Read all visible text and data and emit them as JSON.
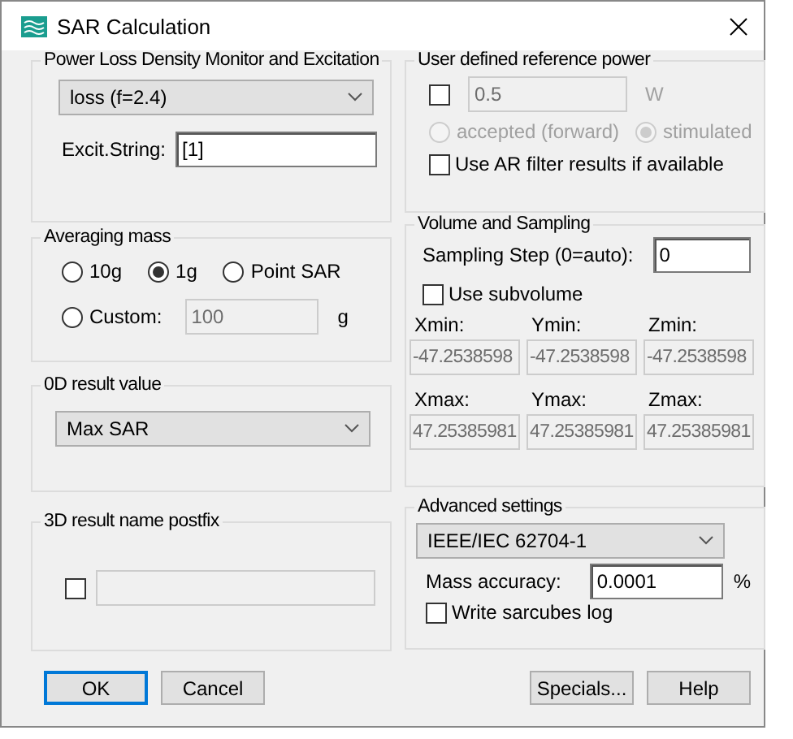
{
  "window": {
    "title": "SAR Calculation"
  },
  "power_loss": {
    "title": "Power Loss Density Monitor and Excitation",
    "monitor": "loss (f=2.4)",
    "excit_label": "Excit.String:",
    "excit_value": "[1]"
  },
  "averaging_mass": {
    "title": "Averaging mass",
    "options": [
      {
        "label": "10g",
        "selected": false
      },
      {
        "label": "1g",
        "selected": true
      },
      {
        "label": "Point SAR",
        "selected": false
      }
    ],
    "custom": {
      "label": "Custom:",
      "selected": false,
      "value": "100",
      "unit": "g",
      "disabled": true
    }
  },
  "result_0d": {
    "title": "0D result value",
    "value": "Max SAR"
  },
  "result_3d": {
    "title": "3D result name postfix",
    "checked": false
  },
  "reference_power": {
    "title": "User defined reference power",
    "checked": false,
    "value": "0.5",
    "unit": "W",
    "disabled": true,
    "modes": [
      {
        "label": "accepted (forward)",
        "selected": false
      },
      {
        "label": "stimulated",
        "selected": true
      }
    ],
    "ar_filter": {
      "label": "Use AR filter results if available",
      "checked": false
    }
  },
  "volume": {
    "title": "Volume and Sampling",
    "step_label": "Sampling Step (0=auto):",
    "step_value": "0",
    "subvolume": {
      "label": "Use subvolume",
      "checked": false
    },
    "bounds_disabled": true,
    "bounds": [
      {
        "label": "Xmin:",
        "value": "-47.2538598"
      },
      {
        "label": "Ymin:",
        "value": "-47.2538598"
      },
      {
        "label": "Zmin:",
        "value": "-47.2538598"
      },
      {
        "label": "Xmax:",
        "value": "47.25385981"
      },
      {
        "label": "Ymax:",
        "value": "47.25385981"
      },
      {
        "label": "Zmax:",
        "value": "47.25385981"
      }
    ]
  },
  "advanced": {
    "title": "Advanced settings",
    "standard": "IEEE/IEC 62704-1",
    "accuracy_label": "Mass accuracy:",
    "accuracy_value": "0.0001",
    "unit": "%",
    "sarcubes": {
      "label": "Write sarcubes log",
      "checked": false
    }
  },
  "buttons": [
    {
      "label": "OK",
      "kind": "default"
    },
    {
      "label": "Cancel",
      "kind": "normal"
    }
  ],
  "right_buttons": [
    {
      "label": "Specials..."
    },
    {
      "label": "Help"
    }
  ]
}
